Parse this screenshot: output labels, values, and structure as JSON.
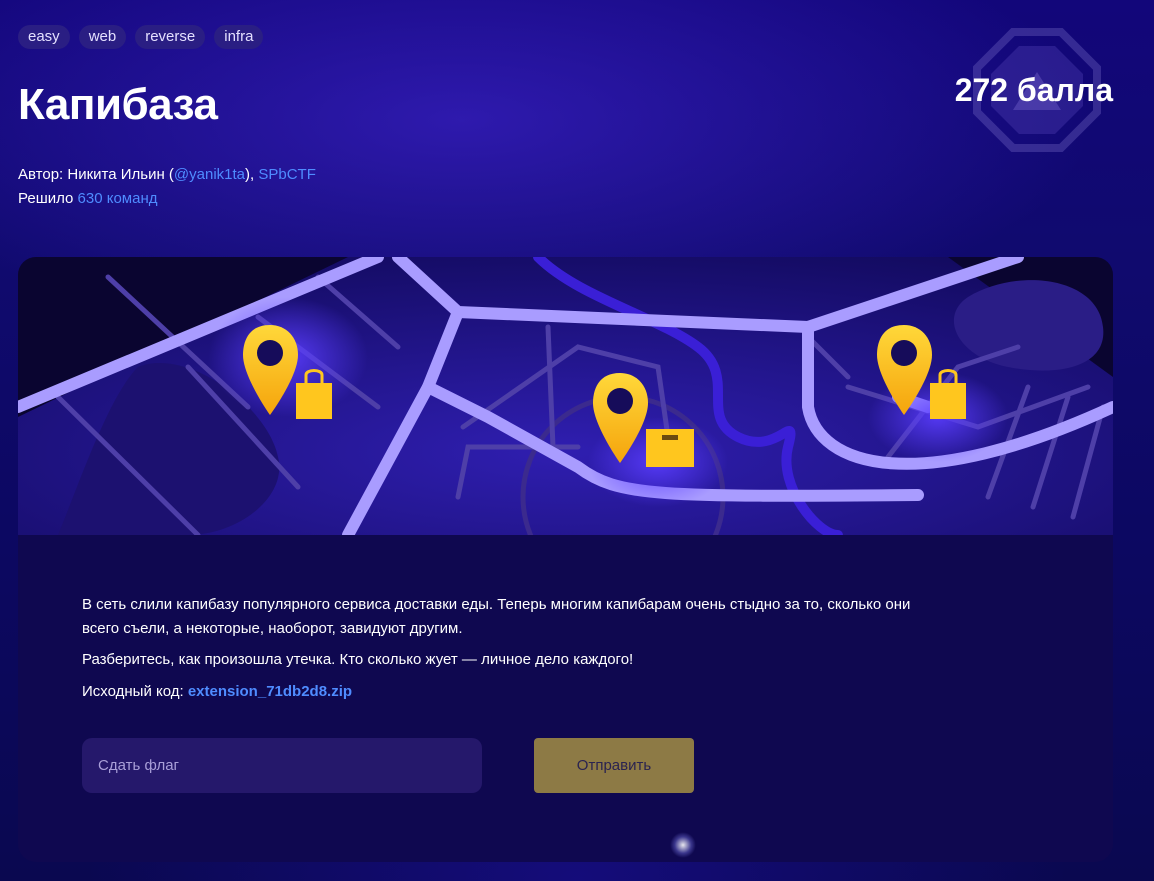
{
  "tags": [
    "easy",
    "web",
    "reverse",
    "infra"
  ],
  "title": "Капибаза",
  "points": "272 балла",
  "author": {
    "prefix": "Автор: Никита Ильин (",
    "handle": "@yanik1ta",
    "mid": "), ",
    "org": "SPbCTF"
  },
  "solved": {
    "prefix": "Решило ",
    "count": "630 команд"
  },
  "description": {
    "p1": "В сеть слили капибазу популярного сервиса доставки еды. Теперь многим капибарам очень стыдно за то, сколько они всего съели, а некоторые, наоборот, завидуют другим.",
    "p2": "Разберитесь, как произошла утечка. Кто сколько жует — личное дело каждого!",
    "source_label": "Исходный код: ",
    "source_file": "extension_71db2d8.zip"
  },
  "flag_form": {
    "placeholder": "Сдать флаг",
    "value": "",
    "submit_label": "Отправить"
  },
  "colors": {
    "background": "#100a6e",
    "card": "#0f0850",
    "link": "#4f8cff",
    "submit_button": "#8d7a45",
    "road": "#a99cff",
    "pin": "#ffc21a"
  },
  "icons": [
    "octagon-badge-icon",
    "map-illustration",
    "location-pin-icon",
    "shopping-bag-icon",
    "parcel-box-icon"
  ]
}
